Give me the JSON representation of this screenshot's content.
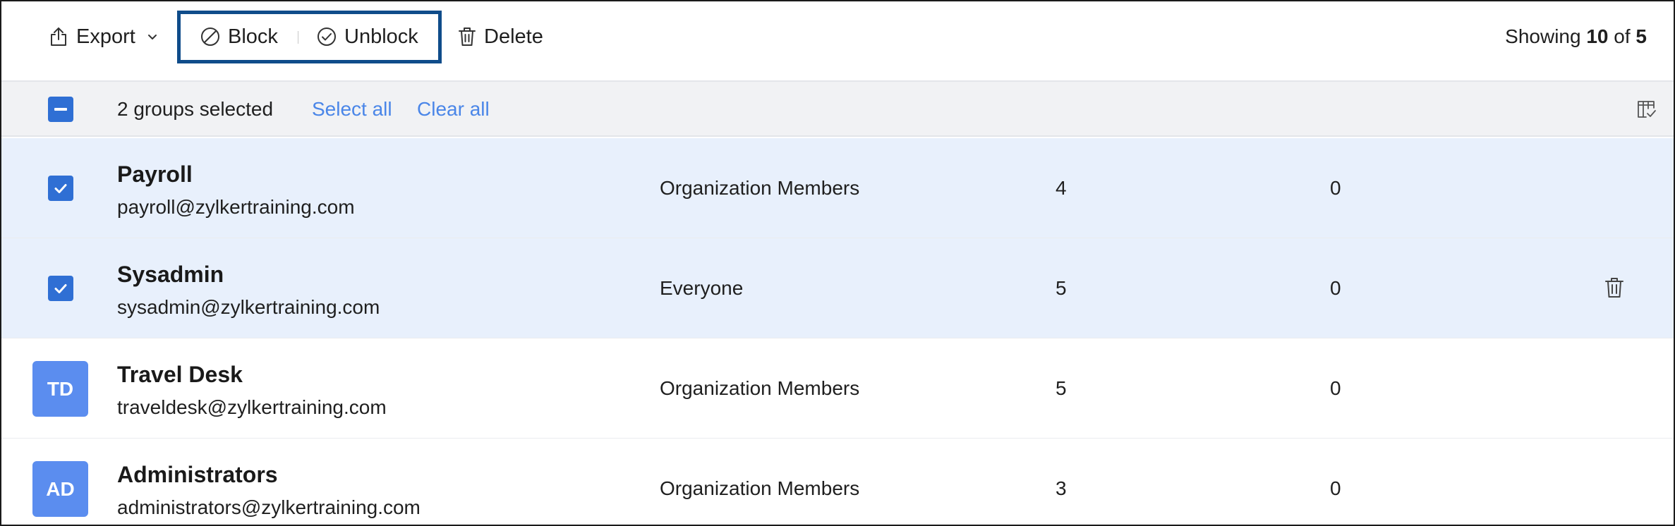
{
  "toolbar": {
    "export_label": "Export",
    "block_label": "Block",
    "unblock_label": "Unblock",
    "delete_label": "Delete",
    "showing_prefix": "Showing",
    "showing_count": "10",
    "showing_of": "of",
    "showing_total": "5"
  },
  "selection": {
    "summary": "2 groups selected",
    "select_all": "Select all",
    "clear_all": "Clear all"
  },
  "rows": [
    {
      "name": "Payroll",
      "email": "payroll@zylkertraining.com",
      "type": "Organization Members",
      "members": "4",
      "other": "0",
      "selected": true
    },
    {
      "name": "Sysadmin",
      "email": "sysadmin@zylkertraining.com",
      "type": "Everyone",
      "members": "5",
      "other": "0",
      "selected": true
    },
    {
      "name": "Travel Desk",
      "email": "traveldesk@zylkertraining.com",
      "type": "Organization Members",
      "members": "5",
      "other": "0",
      "selected": false,
      "initials": "TD"
    },
    {
      "name": "Administrators",
      "email": "administrators@zylkertraining.com",
      "type": "Organization Members",
      "members": "3",
      "other": "0",
      "selected": false,
      "initials": "AD"
    }
  ],
  "colors": {
    "accent": "#2f6fd4",
    "link": "#4a86e8",
    "avatar": "#5b8def",
    "selected_row": "#e8f0fc",
    "highlight_box": "#0f4c8a"
  },
  "icons": {
    "export": "export-icon",
    "block": "block-icon",
    "unblock": "check-circle-icon",
    "delete": "trash-icon",
    "columns": "column-settings-icon"
  }
}
